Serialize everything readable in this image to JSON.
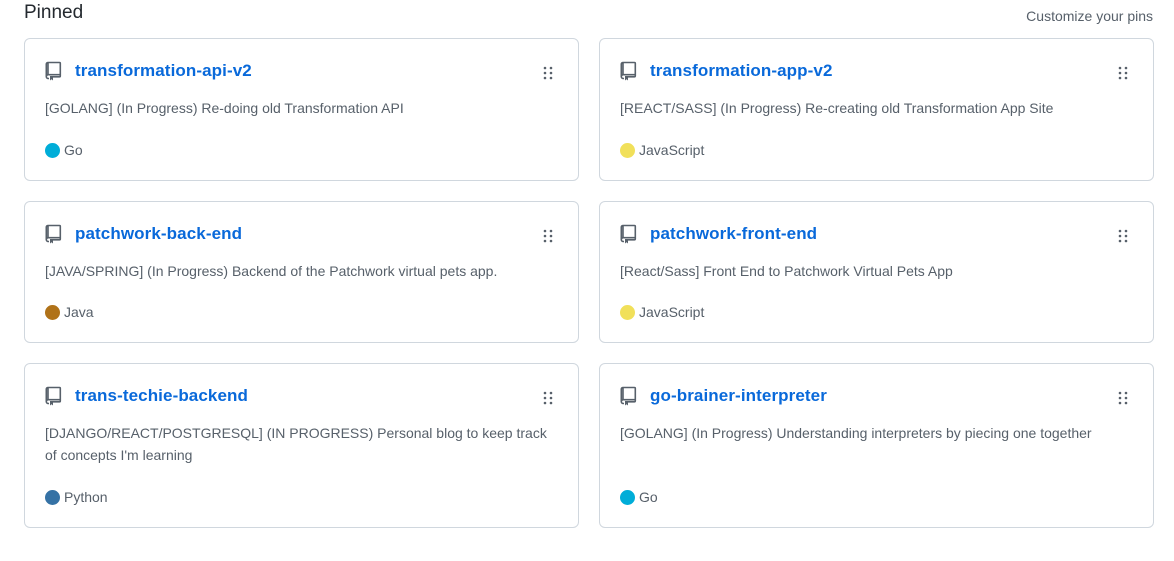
{
  "section": {
    "title": "Pinned",
    "customize_label": "Customize your pins"
  },
  "pins": [
    {
      "name": "transformation-api-v2",
      "description": "[GOLANG] (In Progress) Re-doing old Transformation API",
      "language": "Go",
      "language_color": "#00ADD8"
    },
    {
      "name": "transformation-app-v2",
      "description": "[REACT/SASS] (In Progress) Re-creating old Transformation App Site",
      "language": "JavaScript",
      "language_color": "#f1e05a"
    },
    {
      "name": "patchwork-back-end",
      "description": "[JAVA/SPRING] (In Progress) Backend of the Patchwork virtual pets app.",
      "language": "Java",
      "language_color": "#b07219"
    },
    {
      "name": "patchwork-front-end",
      "description": "[React/Sass] Front End to Patchwork Virtual Pets App",
      "language": "JavaScript",
      "language_color": "#f1e05a"
    },
    {
      "name": "trans-techie-backend",
      "description": "[DJANGO/REACT/POSTGRESQL] (IN PROGRESS) Personal blog to keep track of concepts I'm learning",
      "language": "Python",
      "language_color": "#3572A5"
    },
    {
      "name": "go-brainer-interpreter",
      "description": "[GOLANG] (In Progress) Understanding interpreters by piecing one together",
      "language": "Go",
      "language_color": "#00ADD8"
    }
  ],
  "icons": {
    "repo": "repo-icon",
    "grip": "grabber-icon"
  }
}
